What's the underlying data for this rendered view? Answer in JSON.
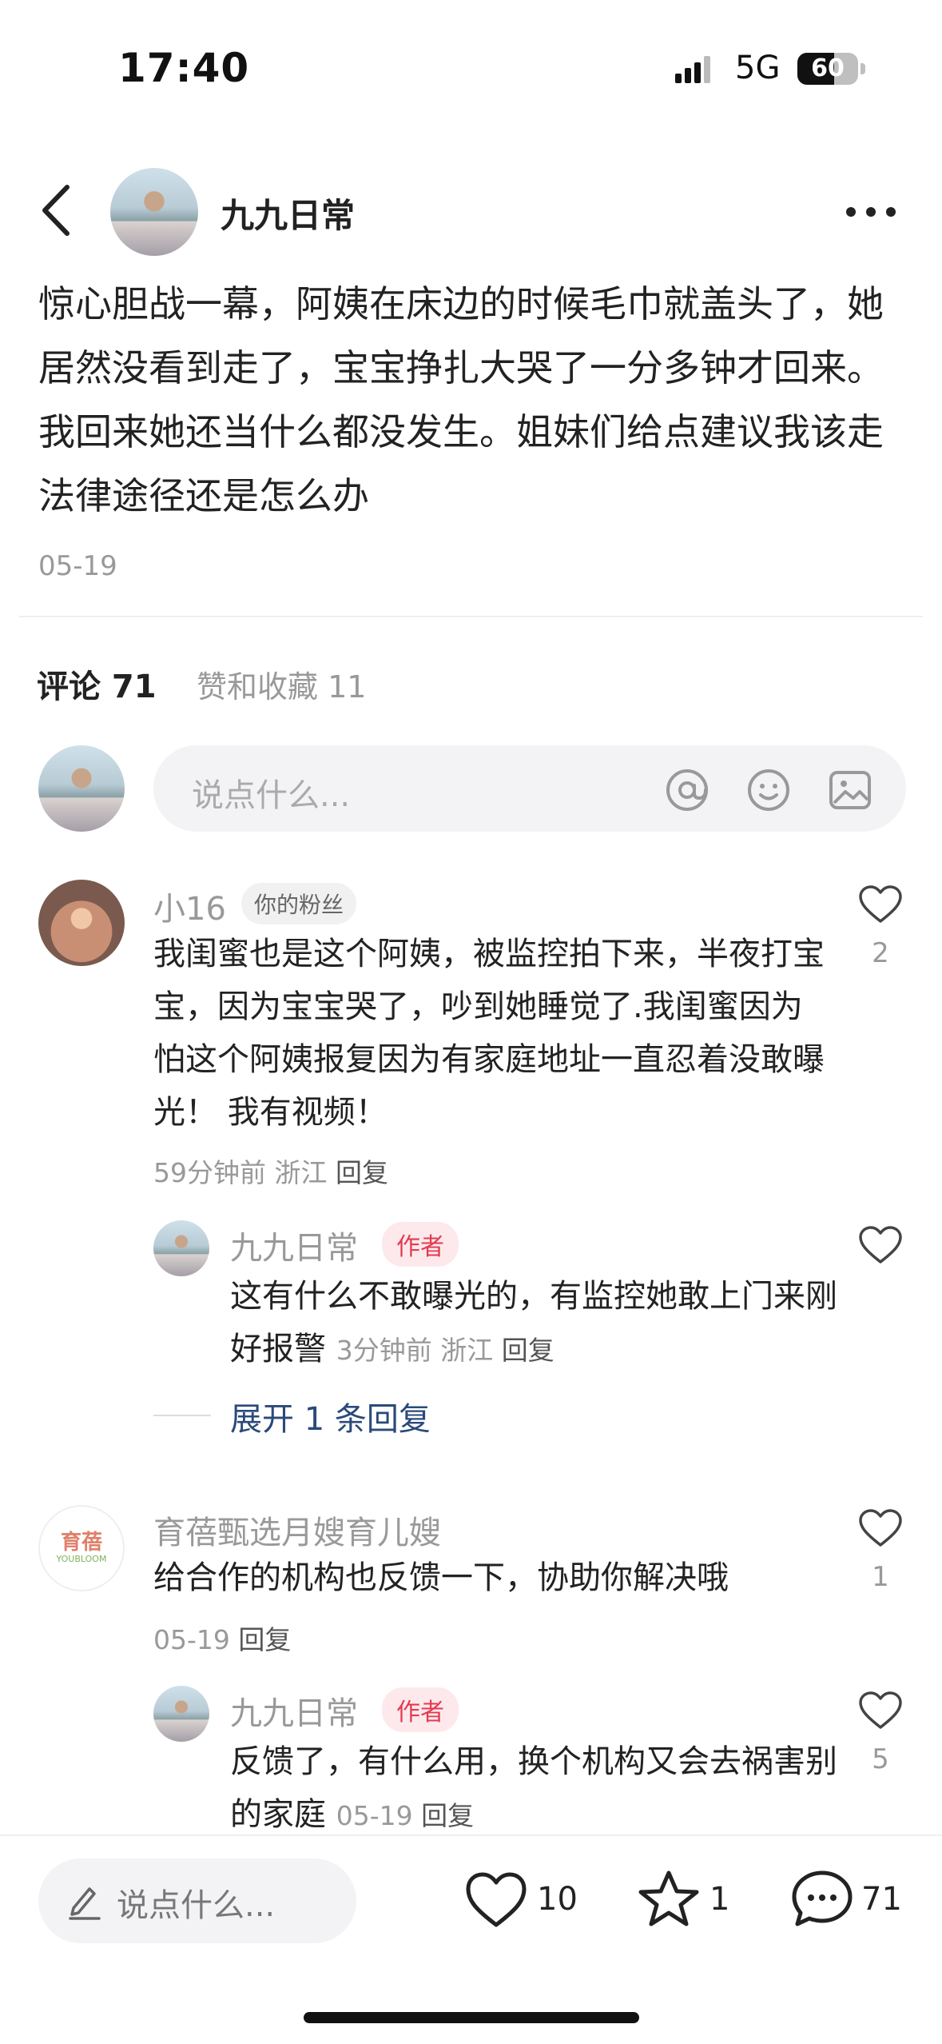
{
  "status_bar": {
    "time": "17:40",
    "network": "5G",
    "battery": "60"
  },
  "header": {
    "author": "九九日常"
  },
  "post": {
    "text": "惊心胆战一幕，阿姨在床边的时候毛巾就盖头了，她居然没看到走了，宝宝挣扎大哭了一分多钟才回来。我回来她还当什么都没发生。姐妹们给点建议我该走法律途径还是怎么办",
    "date": "05-19"
  },
  "tabs": {
    "comments": "评论 71",
    "likes": "赞和收藏 11"
  },
  "comment_input": {
    "placeholder": "说点什么..."
  },
  "comments": [
    {
      "name": "小16",
      "badge": "你的粉丝",
      "text": "我闺蜜也是这个阿姨，被监控拍下来，半夜打宝宝，因为宝宝哭了，吵到她睡觉了.我闺蜜因为怕这个阿姨报复因为有家庭地址一直忍着没敢曝光！ 我有视频！",
      "time": "59分钟前",
      "location": "浙江",
      "reply": "回复",
      "likes": "2",
      "replies": [
        {
          "name": "九九日常",
          "badge": "作者",
          "text": "这有什么不敢曝光的，有监控她敢上门来刚好报警",
          "time": "3分钟前",
          "location": "浙江",
          "reply": "回复",
          "likes": ""
        }
      ],
      "expand": "展开 1 条回复"
    },
    {
      "name": "育蓓甄选月嫂育儿嫂",
      "badge": "",
      "logo_text": "育蓓",
      "logo_sub": "YOUBLOOM",
      "text": "给合作的机构也反馈一下，协助你解决哦",
      "time": "05-19",
      "location": "",
      "reply": "回复",
      "likes": "1",
      "replies": [
        {
          "name": "九九日常",
          "badge": "作者",
          "text": "反馈了，有什么用，换个机构又会去祸害别的家庭",
          "time": "05-19",
          "location": "",
          "reply": "回复",
          "likes": "5"
        }
      ]
    }
  ],
  "bottom_bar": {
    "placeholder": "说点什么...",
    "likes": "10",
    "favorites": "1",
    "comments": "71"
  }
}
